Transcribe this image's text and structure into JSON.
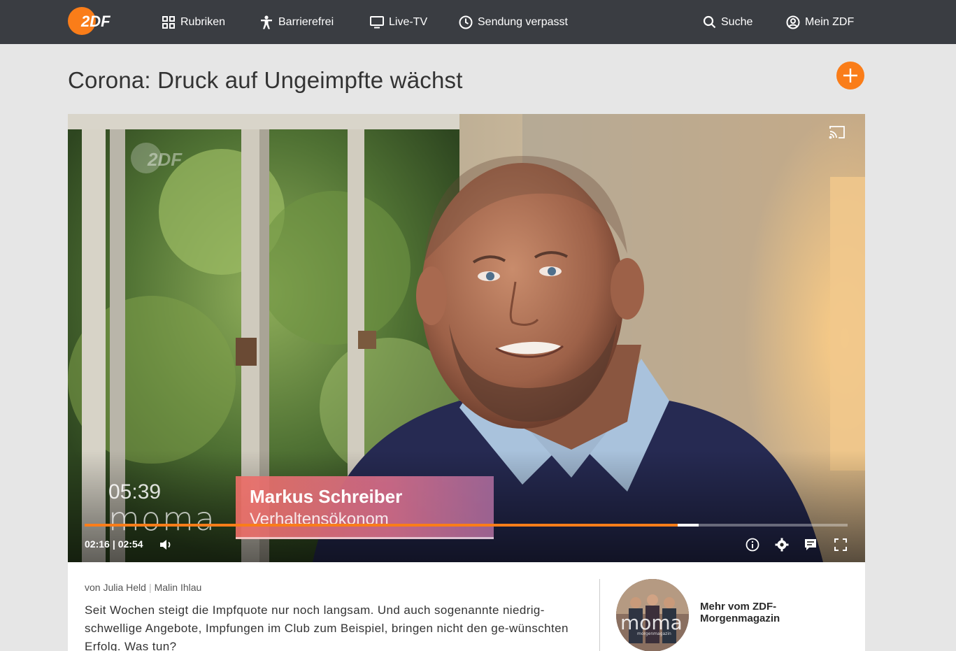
{
  "nav": {
    "logo_text": "2DF",
    "items": [
      {
        "label": "Rubriken",
        "icon": "grid-icon"
      },
      {
        "label": "Barrierefrei",
        "icon": "accessibility-icon"
      },
      {
        "label": "Live-TV",
        "icon": "tv-icon"
      },
      {
        "label": "Sendung verpasst",
        "icon": "clock-icon"
      },
      {
        "label": "Suche",
        "icon": "search-icon"
      },
      {
        "label": "Mein ZDF",
        "icon": "user-icon"
      }
    ]
  },
  "page": {
    "title": "Corona: Druck auf Ungeimpfte wächst"
  },
  "player": {
    "lower_third": {
      "name": "Markus Schreiber",
      "role": "Verhaltensökonom"
    },
    "show_clock": "05:39",
    "show_brand": "moma",
    "time_current": "02:16",
    "time_separator": "|",
    "time_total": "02:54",
    "progress_fraction": 0.777,
    "buffered_fraction": 0.805
  },
  "article": {
    "author_prefix": "von",
    "author_1": "Julia Held",
    "author_2": "Malin Ihlau",
    "teaser": "Seit Wochen steigt die Impfquote nur noch langsam. Und auch sogenannte niedrig-schwellige Angebote, Impfungen im Club zum Beispiel, bringen nicht den ge-wünschten Erfolg. Was tun?"
  },
  "related": {
    "brand": "moma",
    "brand_sub": "morgenmagazin",
    "link_label": "Mehr vom ZDF-Morgenmagazin"
  },
  "colors": {
    "accent": "#fa7d19",
    "topbar": "#3a3d42",
    "background": "#e6e6e6"
  }
}
